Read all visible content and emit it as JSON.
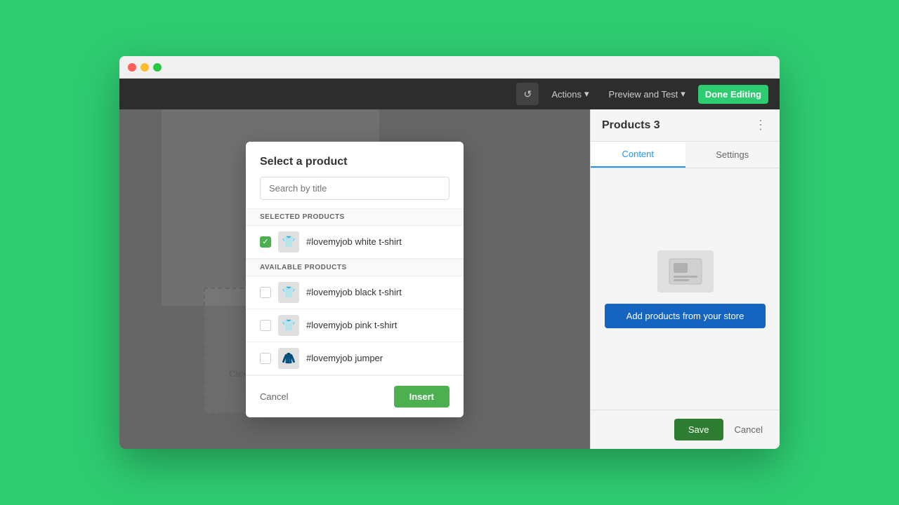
{
  "browser": {
    "traffic_lights": [
      "red",
      "yellow",
      "green"
    ]
  },
  "topbar": {
    "history_icon": "↺",
    "actions_label": "Actions",
    "actions_arrow": "▾",
    "preview_label": "Preview and Test",
    "preview_arrow": "▾",
    "done_editing_label": "Done Editing"
  },
  "panel": {
    "title": "Products 3",
    "dots": "⋮",
    "tabs": [
      {
        "label": "Content",
        "active": true
      },
      {
        "label": "Settings",
        "active": false
      }
    ],
    "add_products_label": "Add products from your store",
    "save_label": "Save",
    "cancel_label": "Cancel"
  },
  "modal": {
    "title": "Select a product",
    "search_placeholder": "Search by title",
    "selected_section_label": "SELECTED PRODUCTS",
    "available_section_label": "AVAILABLE PRODUCTS",
    "selected_products": [
      {
        "id": 1,
        "name": "#lovemyjob white t-shirt",
        "checked": true,
        "thumb": "👕"
      }
    ],
    "available_products": [
      {
        "id": 2,
        "name": "#lovemyjob black t-shirt",
        "checked": false,
        "thumb": "👕"
      },
      {
        "id": 3,
        "name": "#lovemyjob pink t-shirt",
        "checked": false,
        "thumb": "👕"
      },
      {
        "id": 4,
        "name": "#lovemyjob jumper",
        "checked": false,
        "thumb": "🧥"
      }
    ],
    "cancel_label": "Cancel",
    "insert_label": "Insert"
  },
  "canvas": {
    "placeholder_text": "Click here to grab a product"
  }
}
